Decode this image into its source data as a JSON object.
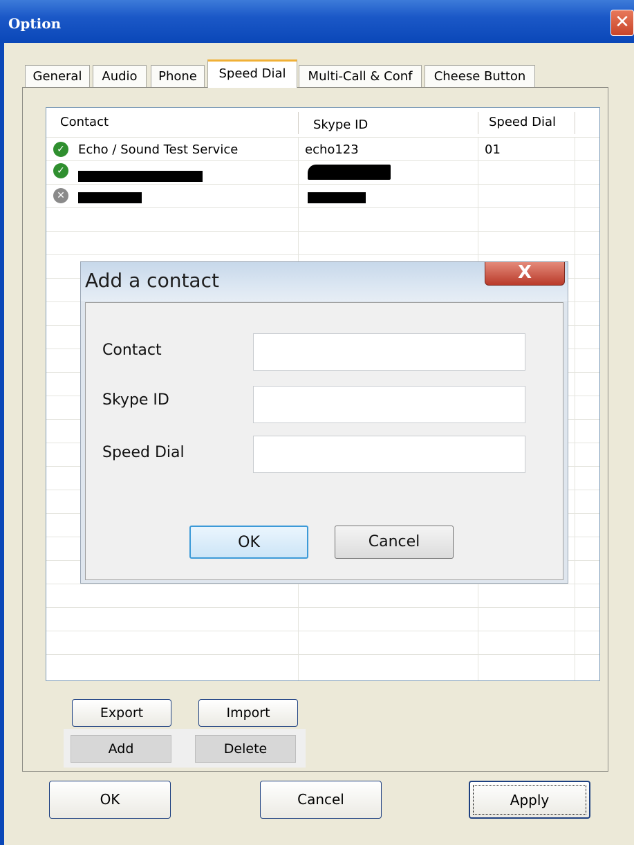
{
  "window": {
    "title": "Option",
    "close_glyph": "✕"
  },
  "tabs": [
    {
      "label": "General"
    },
    {
      "label": "Audio"
    },
    {
      "label": "Phone"
    },
    {
      "label": "Speed Dial"
    },
    {
      "label": "Multi-Call & Conf"
    },
    {
      "label": "Cheese Button"
    }
  ],
  "active_tab": "Speed Dial",
  "list": {
    "columns": [
      "Contact",
      "Skype ID",
      "Speed Dial"
    ],
    "rows": [
      {
        "status": "online",
        "contact": "Echo / Sound Test Service",
        "skype_id": "echo123",
        "speed_dial": "01"
      },
      {
        "status": "online",
        "contact": "",
        "skype_id": "",
        "speed_dial": ""
      },
      {
        "status": "offline",
        "contact": "",
        "skype_id": "",
        "speed_dial": ""
      }
    ]
  },
  "dialog": {
    "title": "Add a contact",
    "close_glyph": "X",
    "fields": [
      {
        "label": "Contact",
        "value": ""
      },
      {
        "label": "Skype ID",
        "value": ""
      },
      {
        "label": "Speed Dial",
        "value": ""
      }
    ],
    "ok_label": "OK",
    "cancel_label": "Cancel"
  },
  "list_buttons": {
    "export": "Export",
    "import": "Import",
    "add": "Add",
    "delete": "Delete"
  },
  "footer": {
    "ok": "OK",
    "cancel": "Cancel",
    "apply": "Apply"
  },
  "status_glyphs": {
    "online": "✓",
    "offline": "✕"
  }
}
